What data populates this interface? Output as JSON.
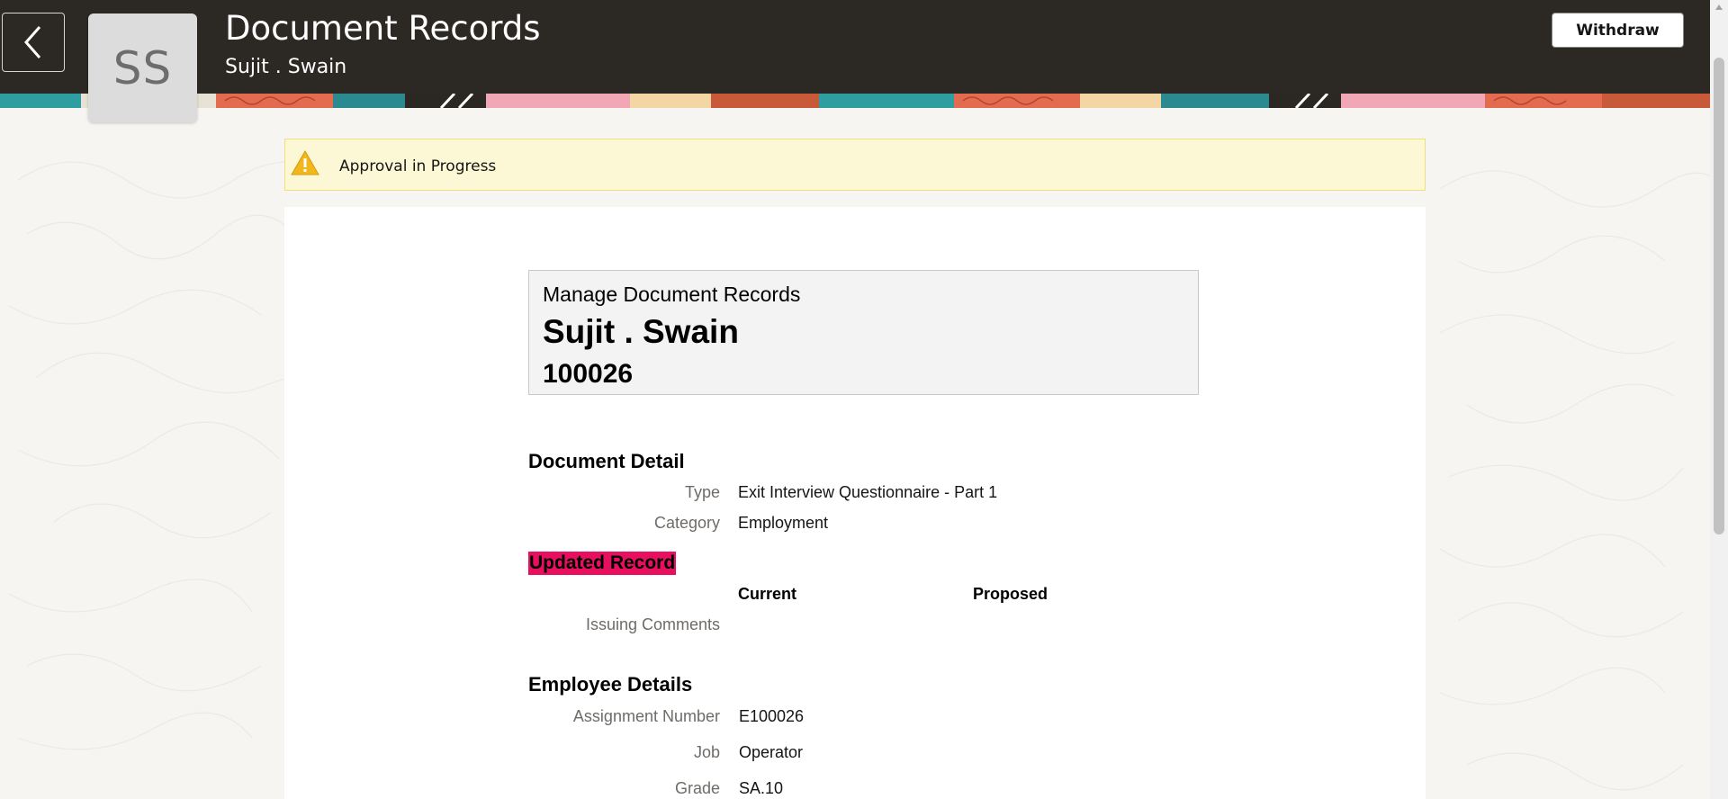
{
  "colors": {
    "header_bg": "#2c2823",
    "alert_bg": "#fcf8d6",
    "alert_border": "#efe07a",
    "highlight": "#e8105e",
    "warning_icon": "#f2b71c"
  },
  "header": {
    "back_icon": "chevron-left-icon",
    "avatar_initials": "SS",
    "title": "Document Records",
    "subtitle": "Sujit . Swain",
    "withdraw_label": "Withdraw"
  },
  "alert": {
    "icon": "warning-icon",
    "text": "Approval in Progress"
  },
  "summary": {
    "heading": "Manage Document Records",
    "name": "Sujit . Swain",
    "number": "100026"
  },
  "document_detail": {
    "title": "Document Detail",
    "type_label": "Type",
    "type_value": "Exit Interview Questionnaire - Part 1",
    "category_label": "Category",
    "category_value": "Employment"
  },
  "updated_record": {
    "title": "Updated Record",
    "current_header": "Current",
    "proposed_header": "Proposed",
    "issuing_comments_label": "Issuing Comments",
    "issuing_comments_current": "",
    "issuing_comments_proposed": ""
  },
  "employee_details": {
    "title": "Employee Details",
    "assignment_label": "Assignment Number",
    "assignment_value": "E100026",
    "job_label": "Job",
    "job_value": "Operator",
    "grade_label": "Grade",
    "grade_value": "SA.10"
  }
}
